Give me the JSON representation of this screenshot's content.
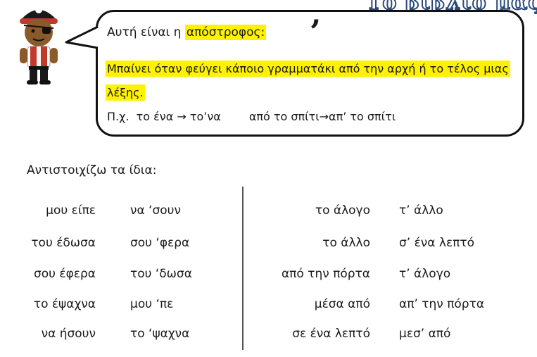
{
  "header": {
    "title_fragment": "Το βιβλίο μας,"
  },
  "bubble": {
    "line1_prefix": "Αυτή είναι η ",
    "line1_term": "απόστροφος:",
    "apostrophe_symbol": "’",
    "rule_text": "Μπαίνει όταν φεύγει κάποιο γραμματάκι από την αρχή ή το τέλος μιας λέξης.",
    "example_label": "Π.χ.",
    "example1": "το ένα → το’να",
    "example2": "από το σπίτι→απ’ το σπίτι"
  },
  "exercise": {
    "instruction": "Αντιστοιχίζω τα ίδια:",
    "left_col1": [
      "μου είπε",
      "του έδωσα",
      "σου έφερα",
      "το έψαχνα",
      "να ήσουν"
    ],
    "left_col2": [
      "να ‘σουν",
      "σου ‘φερα",
      "του ‘δωσα",
      "μου ‘πε",
      "το ‘ψαχνα"
    ],
    "right_col1": [
      "το άλογο",
      "το άλλο",
      "από την πόρτα",
      "μέσα από",
      "σε ένα λεπτό"
    ],
    "right_col2": [
      "τ’ άλλο",
      "σ’ ένα λεπτό",
      "τ’ άλογο",
      "απ’ την πόρτα",
      "μεσ’ από"
    ]
  },
  "colors": {
    "highlight": "#fff200",
    "title_stroke": "#2b4a7a"
  },
  "icons": {
    "character": "pirate-icon"
  }
}
